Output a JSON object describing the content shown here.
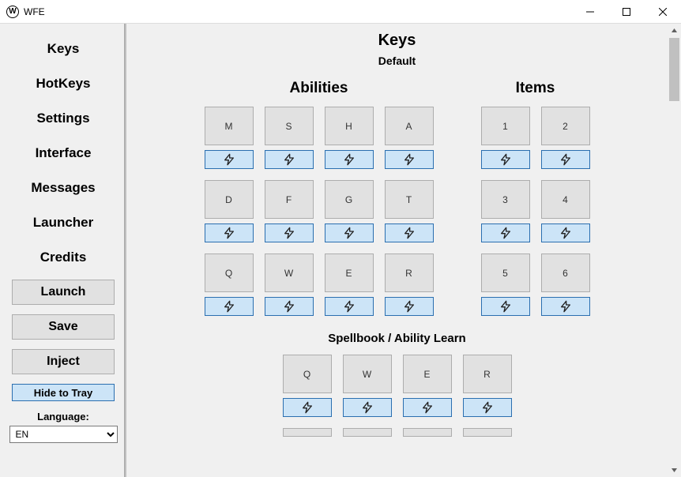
{
  "window": {
    "title": "WFE"
  },
  "sidebar": {
    "nav": [
      "Keys",
      "HotKeys",
      "Settings",
      "Interface",
      "Messages",
      "Launcher",
      "Credits"
    ],
    "buttons": {
      "launch": "Launch",
      "save": "Save",
      "inject": "Inject",
      "hide": "Hide to Tray"
    },
    "language_label": "Language:",
    "language_value": "EN"
  },
  "page": {
    "title": "Keys",
    "subtitle": "Default"
  },
  "abilities": {
    "title": "Abilities",
    "rows": [
      [
        "M",
        "S",
        "H",
        "A"
      ],
      [
        "D",
        "F",
        "G",
        "T"
      ],
      [
        "Q",
        "W",
        "E",
        "R"
      ]
    ]
  },
  "items": {
    "title": "Items",
    "rows": [
      [
        "1",
        "2"
      ],
      [
        "3",
        "4"
      ],
      [
        "5",
        "6"
      ]
    ]
  },
  "spellbook": {
    "title": "Spellbook / Ability Learn",
    "rows": [
      [
        "Q",
        "W",
        "E",
        "R"
      ]
    ]
  }
}
